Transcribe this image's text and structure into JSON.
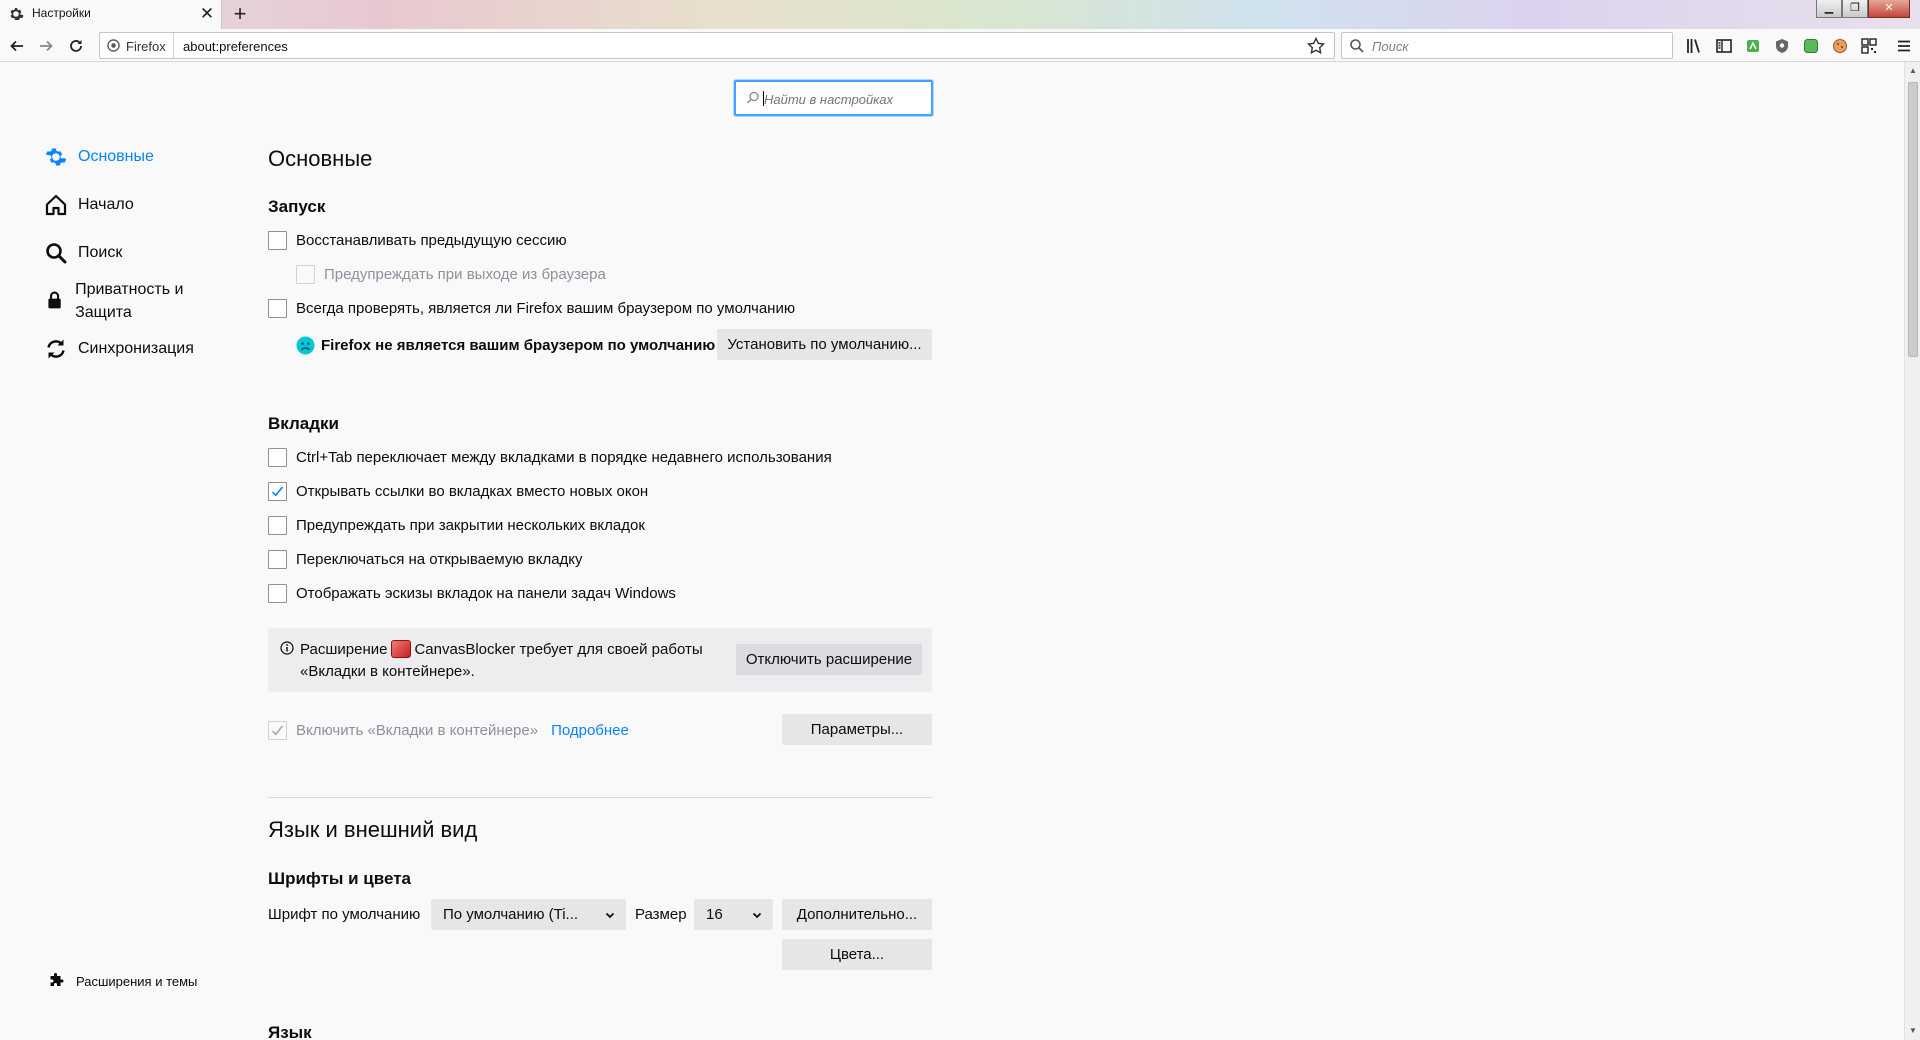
{
  "browser": {
    "tab_title": "Настройки",
    "tab_close": "✕",
    "new_tab": "+",
    "identity_label": "Firefox",
    "url": "about:preferences",
    "search_placeholder": "Поиск"
  },
  "prefs_search": {
    "placeholder": "Найти в настройках"
  },
  "sidebar": {
    "items": [
      {
        "label": "Основные",
        "icon": "gear-icon",
        "selected": true
      },
      {
        "label": "Начало",
        "icon": "home-icon"
      },
      {
        "label": "Поиск",
        "icon": "search-icon"
      },
      {
        "label": "Приватность и Защита",
        "icon": "lock-icon"
      },
      {
        "label": "Синхронизация",
        "icon": "sync-icon"
      }
    ],
    "addons_label": "Расширения и темы"
  },
  "main": {
    "title": "Основные",
    "startup": {
      "heading": "Запуск",
      "restore_session": "Восстанавливать предыдущую сессию",
      "warn_on_quit": "Предупреждать при выходе из браузера",
      "check_default": "Всегда проверять, является ли Firefox вашим браузером по умолчанию",
      "not_default_msg": "Firefox не является вашим браузером по умолчанию",
      "set_default_button": "Установить по умолчанию..."
    },
    "tabs": {
      "heading": "Вкладки",
      "ctrl_tab": "Ctrl+Tab переключает между вкладками в порядке недавнего использования",
      "open_links_in_tabs": "Открывать ссылки во вкладках вместо новых окон",
      "warn_close_multiple": "Предупреждать при закрытии нескольких вкладок",
      "switch_to_new": "Переключаться на открываемую вкладку",
      "show_previews": "Отображать эскизы вкладок на панели задач Windows",
      "notice_prefix": "Расширение",
      "notice_extension": "CanvasBlocker требует для своей работы",
      "notice_line2": "«Вкладки в контейнере».",
      "disable_extension_button": "Отключить расширение",
      "containers_label": "Включить «Вкладки в контейнере»",
      "learn_more": "Подробнее",
      "settings_button": "Параметры..."
    },
    "language_appearance": {
      "title": "Язык и внешний вид",
      "fonts_heading": "Шрифты и цвета",
      "default_font_label": "Шрифт по умолчанию",
      "default_font_value": "По умолчанию (Ti...",
      "size_label": "Размер",
      "size_value": "16",
      "advanced_button": "Дополнительно...",
      "colors_button": "Цвета...",
      "language_heading": "Язык"
    }
  },
  "colors": {
    "accent": "#0a84ff",
    "focus_ring": "#45a1ff"
  }
}
